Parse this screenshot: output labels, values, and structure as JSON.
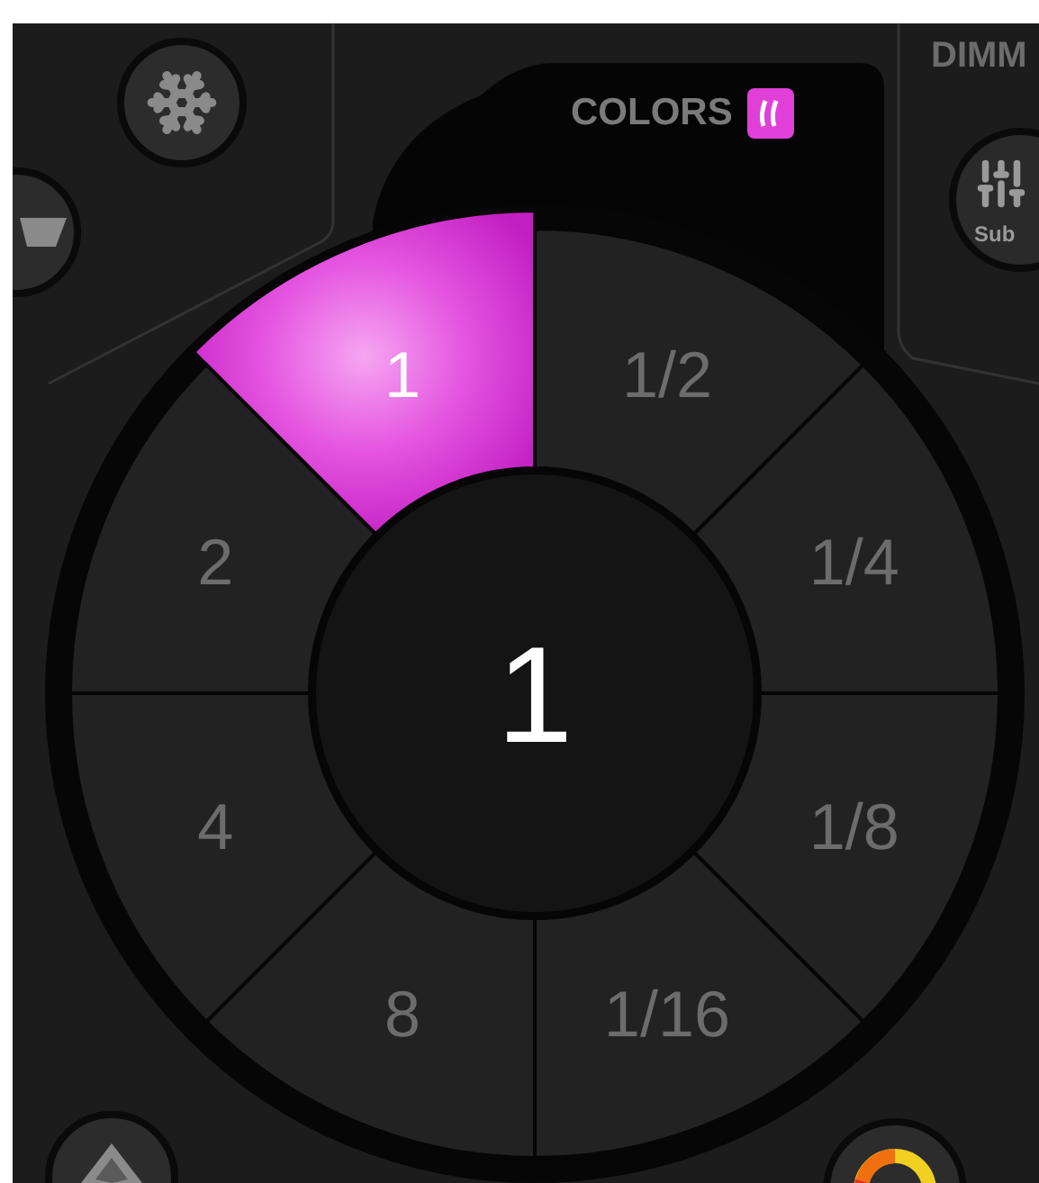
{
  "colors_panel": {
    "title": "COLORS"
  },
  "dimmer": {
    "title": "DIMM",
    "button_label": "Sub"
  },
  "wheel": {
    "center_value": "1",
    "segments": [
      {
        "label": "1",
        "selected": true
      },
      {
        "label": "1/2",
        "selected": false
      },
      {
        "label": "1/4",
        "selected": false
      },
      {
        "label": "1/8",
        "selected": false
      },
      {
        "label": "1/16",
        "selected": false
      },
      {
        "label": "8",
        "selected": false
      },
      {
        "label": "4",
        "selected": false
      },
      {
        "label": "2",
        "selected": false
      }
    ]
  }
}
